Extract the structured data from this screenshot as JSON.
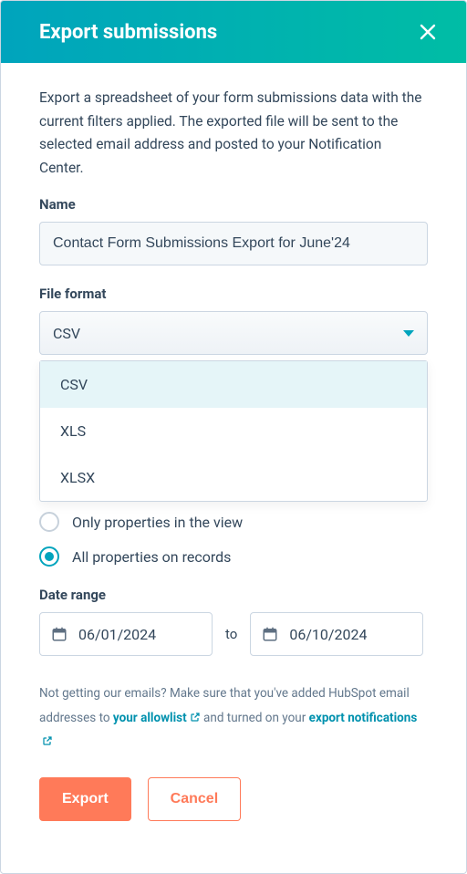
{
  "header": {
    "title": "Export submissions"
  },
  "description": "Export a spreadsheet of your form submissions data with the current filters applied. The exported file will be sent to the selected email address and posted to your Notification Center.",
  "name": {
    "label": "Name",
    "value": "Contact Form Submissions Export for June'24"
  },
  "fileFormat": {
    "label": "File format",
    "selected": "CSV",
    "options": [
      "CSV",
      "XLS",
      "XLSX"
    ]
  },
  "properties": {
    "option1": "Only properties in the view",
    "option2": "All properties on records",
    "selected": "all"
  },
  "dateRange": {
    "label": "Date range",
    "from": "06/01/2024",
    "to_label": "to",
    "to": "06/10/2024"
  },
  "hint": {
    "prefix": "Not getting our emails? Make sure that you've added HubSpot email addresses to ",
    "link1": "your allowlist",
    "mid": " and turned on your ",
    "link2": "export notifications"
  },
  "buttons": {
    "export": "Export",
    "cancel": "Cancel"
  }
}
